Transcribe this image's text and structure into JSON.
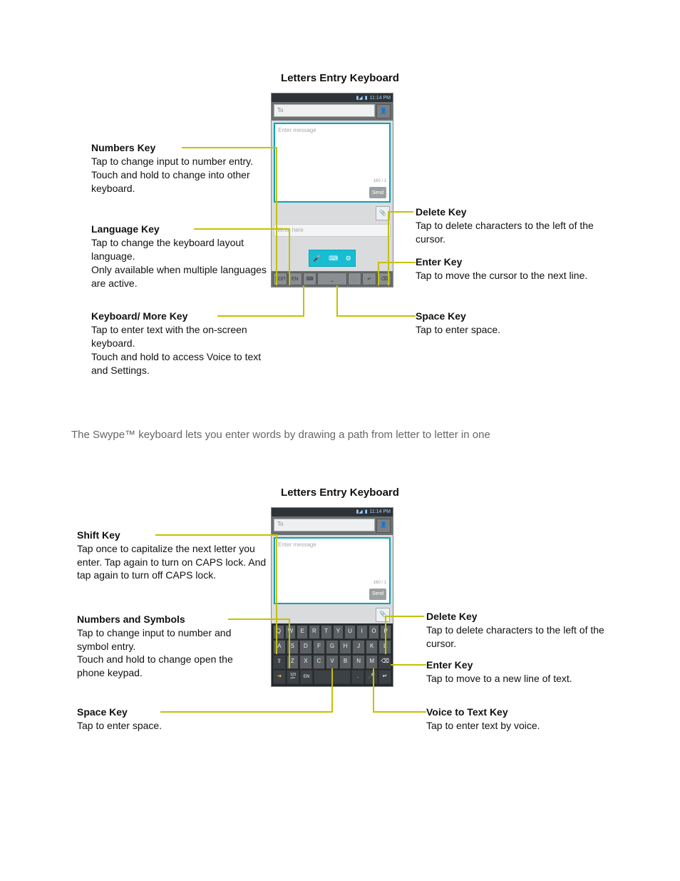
{
  "section1": {
    "title": "Letters Entry Keyboard",
    "statusTime": "11:14 PM",
    "toPlaceholder": "To",
    "messagePlaceholder": "Enter message",
    "charCount": "160 / 1",
    "sendLabel": "Send",
    "writeHere": "Write here",
    "keysRow": {
      "numbers": "123?",
      "lang": "EN",
      "more": "⌨",
      "space": "⎵",
      "dot": ".",
      "enter": "↵",
      "delete": "⌫"
    },
    "callouts": {
      "numbers": {
        "heading": "Numbers Key",
        "body": "Tap to change input to number entry.\nTouch and hold to change into other keyboard."
      },
      "language": {
        "heading": "Language Key",
        "body": "Tap to change the keyboard layout language.\nOnly available when multiple languages are active."
      },
      "more": {
        "heading": "Keyboard/ More Key",
        "body": "Tap to enter text with the on-screen keyboard.\nTouch and hold to access Voice to text and Settings."
      },
      "delete": {
        "heading": "Delete Key",
        "body": "Tap to delete characters to the left of the cursor."
      },
      "enter": {
        "heading": "Enter Key",
        "body": "Tap to move the cursor to the next line."
      },
      "space": {
        "heading": "Space Key",
        "body": "Tap to enter space."
      }
    }
  },
  "swypePara": "The Swype™ keyboard lets you enter words by drawing a path from letter to letter in one",
  "section2": {
    "title": "Letters Entry Keyboard",
    "statusTime": "11:14 PM",
    "toPlaceholder": "To",
    "messagePlaceholder": "Enter message",
    "charCount": "160 / 1",
    "sendLabel": "Send",
    "keyboard": {
      "row1": [
        "Q",
        "W",
        "E",
        "R",
        "T",
        "Y",
        "U",
        "I",
        "O",
        "P"
      ],
      "row2": [
        "A",
        "S",
        "D",
        "F",
        "G",
        "H",
        "J",
        "K",
        "L"
      ],
      "row3": {
        "shift": "⇧",
        "keys": [
          "Z",
          "X",
          "C",
          "V",
          "B",
          "N",
          "M"
        ],
        "del": "⌫"
      },
      "row4": {
        "swype": "➜",
        "numSym": "123\n+!=",
        "lang": "EN",
        "space": " ",
        "period": ".",
        "mic": "🎤",
        "enter": "↵"
      }
    },
    "callouts": {
      "shift": {
        "heading": "Shift Key",
        "body": "Tap once to capitalize the next letter you enter. Tap again to turn on CAPS lock. And tap again to turn off CAPS lock."
      },
      "numsym": {
        "heading": "Numbers and Symbols",
        "body": "Tap to change input to number and symbol entry.\nTouch and hold to change open the phone keypad."
      },
      "space": {
        "heading": "Space Key",
        "body": "Tap to enter space."
      },
      "delete": {
        "heading": "Delete Key",
        "body": "Tap to delete characters to the left of the cursor."
      },
      "enter": {
        "heading": "Enter Key",
        "body": "Tap to move to a new line of text."
      },
      "voice": {
        "heading": "Voice to Text Key",
        "body": "Tap to enter text by voice."
      }
    }
  }
}
